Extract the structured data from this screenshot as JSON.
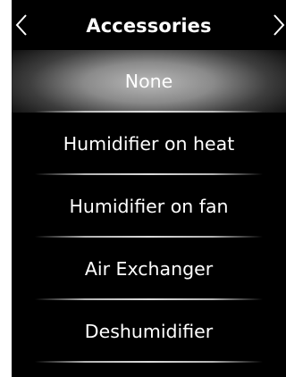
{
  "header": {
    "title": "Accessories",
    "prev_icon": "chevron-left-icon",
    "next_icon": "chevron-right-icon"
  },
  "options": [
    {
      "label": "None",
      "selected": true
    },
    {
      "label": "Humidifier on heat",
      "selected": false
    },
    {
      "label": "Humidifier on fan",
      "selected": false
    },
    {
      "label": "Air Exchanger",
      "selected": false
    },
    {
      "label": "Deshumidifier",
      "selected": false
    }
  ],
  "colors": {
    "screen_background": "#000000",
    "text": "#ffffff",
    "selected_highlight": "#8a8a8a"
  }
}
